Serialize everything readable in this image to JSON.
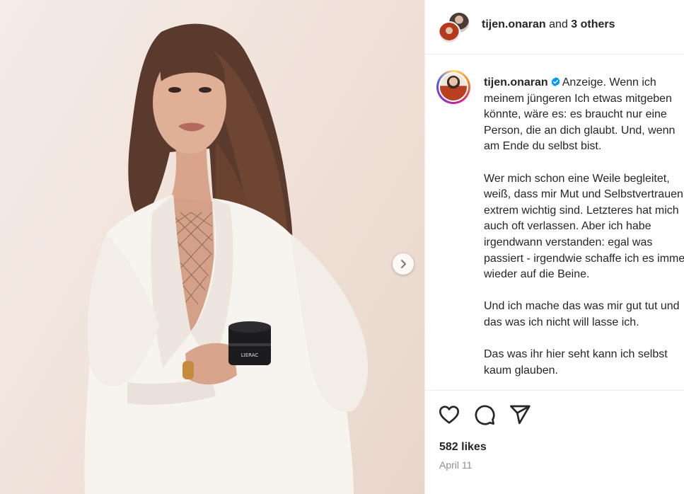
{
  "header": {
    "username": "tijen.onaran",
    "connector": "and",
    "others": "3 others"
  },
  "caption": {
    "username": "tijen.onaran",
    "paragraphs": [
      [
        "Anzeige. Wenn ich",
        "meinem jüngeren Ich etwas mitgeben",
        "könnte, wäre es: es braucht nur eine",
        "Person, die an dich glaubt. Und, wenn",
        "am Ende du selbst bist."
      ],
      [
        "Wer mich schon eine Weile begleitet,",
        "weiß, dass mir Mut und Selbstvertrauen",
        "extrem wichtig sind. Letzteres hat mich",
        "auch oft verlassen. Aber ich habe",
        "irgendwann verstanden: egal was",
        "passiert - irgendwie schaffe ich es immer",
        "wieder auf die Beine."
      ],
      [
        "Und ich mache das was mir gut tut und",
        "das was ich nicht will lasse ich."
      ],
      [
        "Das was ihr hier seht kann ich selbst",
        "kaum glauben."
      ]
    ]
  },
  "product": {
    "brand": "LIERAC"
  },
  "stats": {
    "likes": "582 likes",
    "date": "April 11"
  },
  "icons": {
    "like": "heart-icon",
    "comment": "comment-icon",
    "share": "share-icon",
    "next": "chevron-right-icon",
    "verified": "verified-badge-icon"
  },
  "colors": {
    "verified": "#0095f6",
    "text": "#262626",
    "muted": "#8e8e8e"
  }
}
